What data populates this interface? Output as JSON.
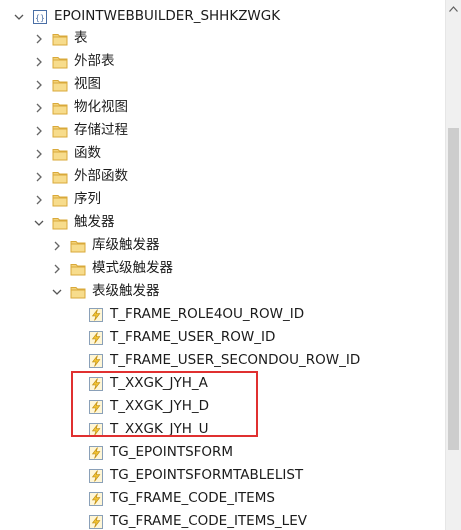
{
  "tree": {
    "root": {
      "label": "EPOINTWEBBUILDER_SHHKZWGK",
      "icon": "database-icon",
      "expanded": true
    },
    "folders": [
      {
        "label": "表",
        "icon": "folder-icon",
        "expanded": false
      },
      {
        "label": "外部表",
        "icon": "folder-icon",
        "expanded": false
      },
      {
        "label": "视图",
        "icon": "folder-icon",
        "expanded": false
      },
      {
        "label": "物化视图",
        "icon": "folder-icon",
        "expanded": false
      },
      {
        "label": "存储过程",
        "icon": "folder-icon",
        "expanded": false
      },
      {
        "label": "函数",
        "icon": "folder-icon",
        "expanded": false
      },
      {
        "label": "外部函数",
        "icon": "folder-icon",
        "expanded": false
      },
      {
        "label": "序列",
        "icon": "folder-icon",
        "expanded": false
      },
      {
        "label": "触发器",
        "icon": "folder-icon",
        "expanded": true
      }
    ],
    "trigger_groups": [
      {
        "label": "库级触发器",
        "icon": "folder-icon",
        "expanded": false
      },
      {
        "label": "模式级触发器",
        "icon": "folder-icon",
        "expanded": false
      },
      {
        "label": "表级触发器",
        "icon": "folder-icon",
        "expanded": true
      }
    ],
    "table_triggers": [
      {
        "label": "T_FRAME_ROLE4OU_ROW_ID",
        "icon": "trigger-icon"
      },
      {
        "label": "T_FRAME_USER_ROW_ID",
        "icon": "trigger-icon"
      },
      {
        "label": "T_FRAME_USER_SECONDOU_ROW_ID",
        "icon": "trigger-icon"
      },
      {
        "label": "T_XXGK_JYH_A",
        "icon": "trigger-icon"
      },
      {
        "label": "T_XXGK_JYH_D",
        "icon": "trigger-icon"
      },
      {
        "label": "T_XXGK_JYH_U",
        "icon": "trigger-icon"
      },
      {
        "label": "TG_EPOINTSFORM",
        "icon": "trigger-icon"
      },
      {
        "label": "TG_EPOINTSFORMTABLELIST",
        "icon": "trigger-icon"
      },
      {
        "label": "TG_FRAME_CODE_ITEMS",
        "icon": "trigger-icon"
      },
      {
        "label": "TG_FRAME_CODE_ITEMS_LEV",
        "icon": "trigger-icon"
      }
    ]
  },
  "colors": {
    "highlight_border": "#e03030",
    "folder": "#e8c05a",
    "trigger": "#f1c232"
  }
}
